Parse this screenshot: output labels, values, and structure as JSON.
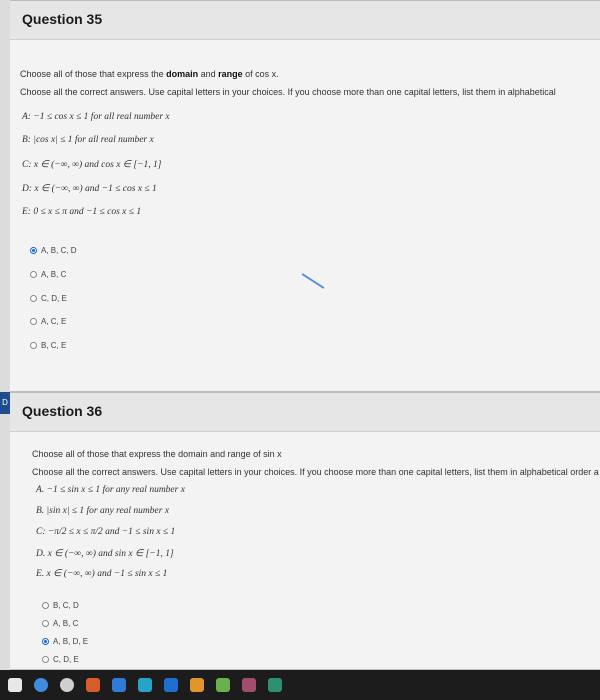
{
  "q35": {
    "title": "Question 35",
    "prompt_prefix": "Choose all of those that express the ",
    "prompt_bold": "domain",
    "prompt_mid": " and ",
    "prompt_bold2": "range",
    "prompt_suffix": " of cos x.",
    "instruction": "Choose all the correct answers. Use capital letters in your choices. If you choose more than one capital letters, list them in alphabetical",
    "options": [
      "A:  −1 ≤ cos x ≤ 1 for all real number x",
      "B:  |cos x| ≤ 1 for all real number x",
      "C:  x ∈ (−∞, ∞)  and  cos x ∈ [−1, 1]",
      "D:  x ∈ (−∞, ∞)  and   −1 ≤ cos x ≤ 1",
      "E:  0 ≤ x ≤ π  and  −1 ≤ cos x ≤ 1"
    ],
    "choices": [
      "A, B, C, D",
      "A, B, C",
      "C, D, E",
      "A, C, E",
      "B, C, E"
    ],
    "selected_index": 0
  },
  "q36": {
    "title": "Question 36",
    "prompt": "Choose all of those that express the domain and range of sin x",
    "instruction": "Choose all the correct answers. Use capital letters in your choices. If you choose more than one capital letters, list them in alphabetical order a",
    "options": [
      "A.  −1 ≤ sin x ≤ 1 for any real number x",
      "B.  |sin x| ≤ 1 for any real number x",
      "C:  −π/2 ≤ x ≤ π/2  and  −1 ≤ sin x ≤ 1",
      "D.  x ∈ (−∞, ∞)  and  sin x ∈ [−1, 1]",
      "E.  x ∈ (−∞, ∞)  and  −1 ≤ sin x ≤ 1"
    ],
    "choices": [
      "B, C, D",
      "A, B, C",
      "A, B, D, E",
      "C, D, E"
    ],
    "selected_index": 2
  },
  "side_tab": "D",
  "colors": {
    "accent": "#1565c0",
    "taskbar": "#1c1c1c"
  },
  "taskbar_icons": [
    "windows-icon",
    "chrome-icon",
    "cortana-icon",
    "photos-icon",
    "store-icon",
    "mail-icon"
  ]
}
